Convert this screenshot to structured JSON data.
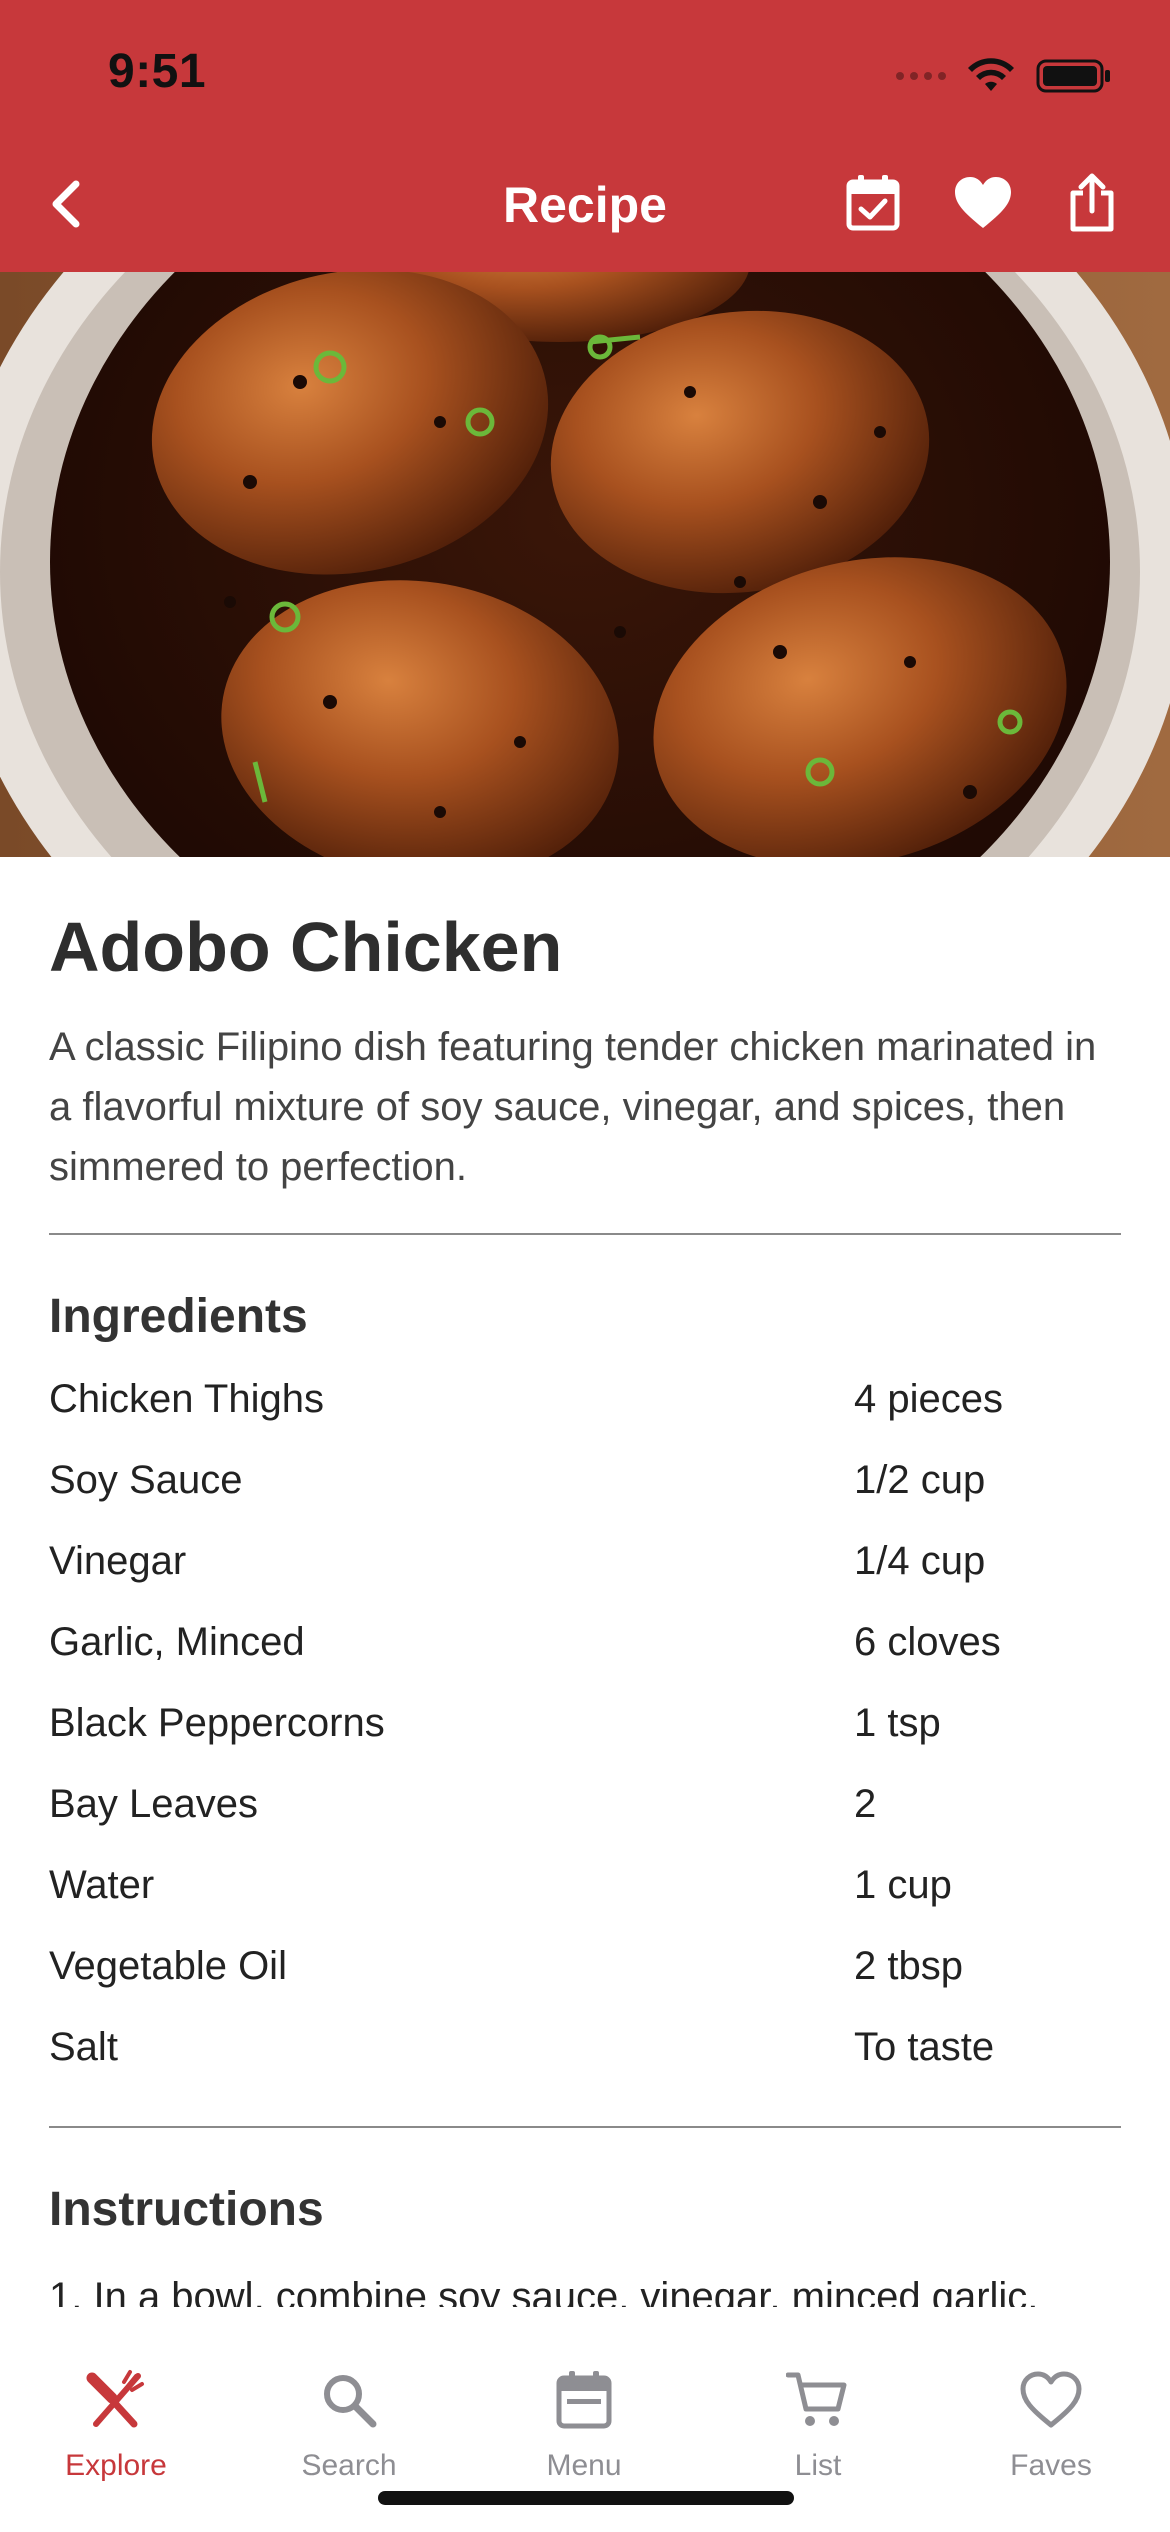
{
  "status_bar": {
    "time": "9:51"
  },
  "nav": {
    "title": "Recipe"
  },
  "recipe": {
    "title": "Adobo Chicken",
    "description": "A classic Filipino dish featuring tender chicken marinated in a flavorful mixture of soy sauce, vinegar, and spices, then simmered to perfection."
  },
  "ingredients": {
    "heading": "Ingredients",
    "items": [
      {
        "name": "Chicken Thighs",
        "qty": "4 pieces"
      },
      {
        "name": "Soy Sauce",
        "qty": "1/2 cup"
      },
      {
        "name": "Vinegar",
        "qty": "1/4 cup"
      },
      {
        "name": "Garlic, Minced",
        "qty": "6 cloves"
      },
      {
        "name": "Black Peppercorns",
        "qty": "1 tsp"
      },
      {
        "name": "Bay Leaves",
        "qty": "2"
      },
      {
        "name": "Water",
        "qty": "1 cup"
      },
      {
        "name": "Vegetable Oil",
        "qty": "2 tbsp"
      },
      {
        "name": "Salt",
        "qty": "To taste"
      }
    ]
  },
  "instructions": {
    "heading": "Instructions",
    "first_line": "1. In a bowl, combine soy sauce, vinegar, minced garlic,"
  },
  "tabs": [
    {
      "label": "Explore",
      "icon": "fork-knife-icon",
      "active": true
    },
    {
      "label": "Search",
      "icon": "search-icon",
      "active": false
    },
    {
      "label": "Menu",
      "icon": "calendar-icon",
      "active": false
    },
    {
      "label": "List",
      "icon": "cart-icon",
      "active": false
    },
    {
      "label": "Faves",
      "icon": "heart-icon",
      "active": false
    }
  ],
  "colors": {
    "brand": "#c7383b",
    "inactive_tab": "#8e8e93"
  }
}
